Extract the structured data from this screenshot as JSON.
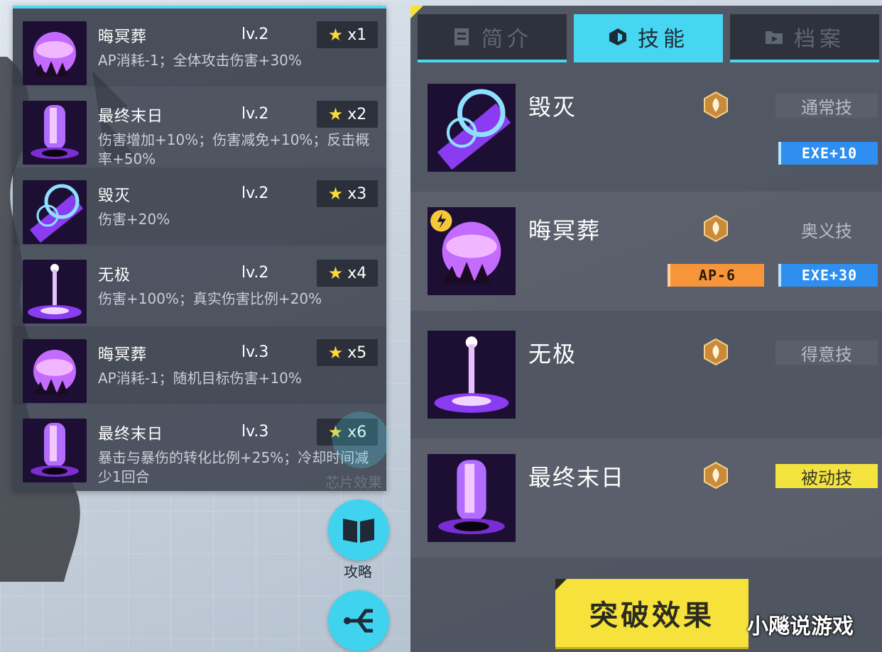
{
  "chips": [
    {
      "name": "晦冥葬",
      "level": "lv.2",
      "count": "x1",
      "desc": "AP消耗-1；全体攻击伤害+30%",
      "icon": "orb-skill-icon"
    },
    {
      "name": "最终末日",
      "level": "lv.2",
      "count": "x2",
      "desc": "伤害增加+10%；伤害减免+10%；反击概率+50%",
      "icon": "pillar-skill-icon"
    },
    {
      "name": "毁灭",
      "level": "lv.2",
      "count": "x3",
      "desc": "伤害+20%",
      "icon": "ring-skill-icon"
    },
    {
      "name": "无极",
      "level": "lv.2",
      "count": "x4",
      "desc": "伤害+100%；真实伤害比例+20%",
      "icon": "beam-skill-icon"
    },
    {
      "name": "晦冥葬",
      "level": "lv.3",
      "count": "x5",
      "desc": "AP消耗-1；随机目标伤害+10%",
      "icon": "orb-skill-icon"
    },
    {
      "name": "最终末日",
      "level": "lv.3",
      "count": "x6",
      "desc": "暴击与暴伤的转化比例+25%；冷却时间减少1回合",
      "icon": "pillar-skill-icon"
    }
  ],
  "side": {
    "chip_effect_label": "芯片效果",
    "guide_label": "攻略"
  },
  "tabs": [
    {
      "label": "简介",
      "icon": "profile-icon",
      "active": false
    },
    {
      "label": "技能",
      "icon": "skill-icon",
      "active": true
    },
    {
      "label": "档案",
      "icon": "folder-icon",
      "active": false
    }
  ],
  "skills": [
    {
      "name": "毁灭",
      "type": "通常技",
      "tags": [
        "EXE+10"
      ],
      "icon": "ring-skill-icon"
    },
    {
      "name": "晦冥葬",
      "type": "奥义技",
      "tags": [
        "AP-6",
        "EXE+30"
      ],
      "icon": "orb-skill-icon"
    },
    {
      "name": "无极",
      "type": "得意技",
      "tags": [],
      "icon": "beam-skill-icon"
    },
    {
      "name": "最终末日",
      "type": "被动技",
      "tags": [],
      "icon": "pillar-skill-icon"
    }
  ],
  "breakthrough_label": "突破效果",
  "watermark": "小飚说游戏",
  "colors": {
    "accent": "#46d6f1",
    "yellow": "#f6e23a",
    "exe": "#2f8ff0",
    "ap": "#f7953a",
    "purple": "#a347ff"
  }
}
